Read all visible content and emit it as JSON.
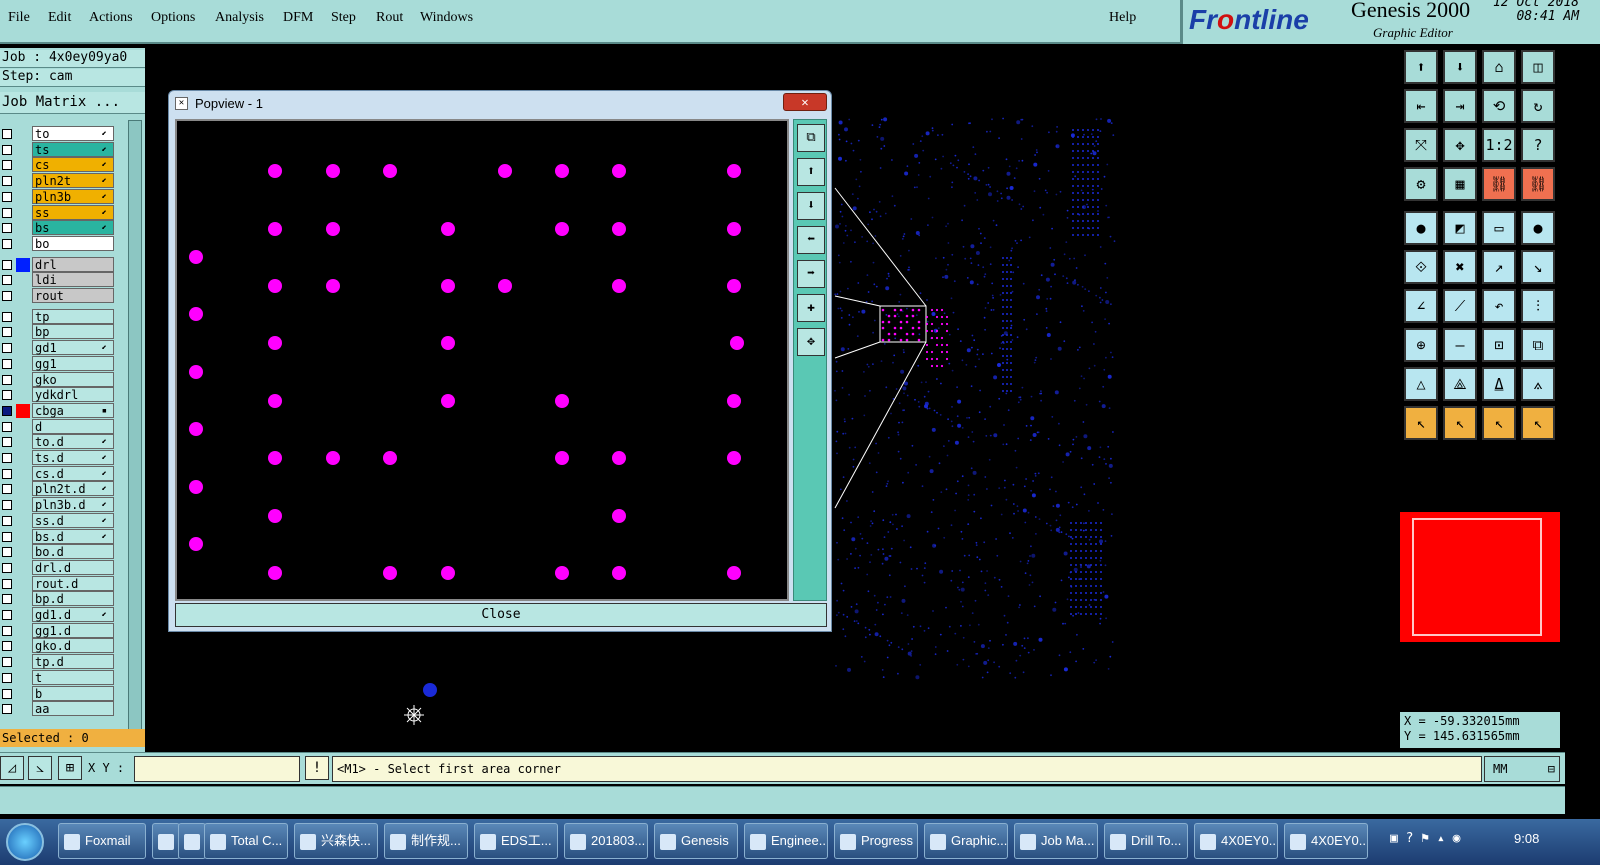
{
  "menu": [
    "File",
    "Edit",
    "Actions",
    "Options",
    "Analysis",
    "DFM",
    "Step",
    "Rout",
    "Windows"
  ],
  "help": "Help",
  "brand": {
    "logo_prefix": "Fr",
    "logo_o": "o",
    "logo_suffix": "ntline",
    "product": "Genesis 2000",
    "subtitle": "Graphic Editor",
    "date": "12 Oct 2018",
    "time": "08:41 AM"
  },
  "job": {
    "job_line": "Job : 4x0ey09ya0",
    "step_line": "Step: cam",
    "matrix_button": "Job Matrix ..."
  },
  "layers": [
    {
      "name": "to",
      "color": "#ffffff",
      "swatch": "",
      "arrow": "⬋"
    },
    {
      "name": "ts",
      "color": "#2ab4a0",
      "swatch": "",
      "arrow": "⬋"
    },
    {
      "name": "cs",
      "color": "#f0b000",
      "swatch": "",
      "arrow": "⬋"
    },
    {
      "name": "pln2t",
      "color": "#f0b000",
      "swatch": "",
      "arrow": "⬋"
    },
    {
      "name": "pln3b",
      "color": "#f0b000",
      "swatch": "",
      "arrow": "⬋"
    },
    {
      "name": "ss",
      "color": "#f0b000",
      "swatch": "",
      "arrow": "⬋"
    },
    {
      "name": "bs",
      "color": "#2ab4a0",
      "swatch": "",
      "arrow": "⬋"
    },
    {
      "name": "bo",
      "color": "#ffffff",
      "swatch": "",
      "arrow": ""
    },
    {
      "name": "drl",
      "color": "#c8c8c8",
      "swatch": "#0020ff",
      "arrow": ""
    },
    {
      "name": "ldi",
      "color": "#c8c8c8",
      "swatch": "",
      "arrow": ""
    },
    {
      "name": "rout",
      "color": "#c8c8c8",
      "swatch": "",
      "arrow": ""
    },
    {
      "name": "tp",
      "color": "#b8e6e2",
      "swatch": "",
      "arrow": ""
    },
    {
      "name": "bp",
      "color": "#b8e6e2",
      "swatch": "",
      "arrow": ""
    },
    {
      "name": "gd1",
      "color": "#b8e6e2",
      "swatch": "",
      "arrow": "⬋"
    },
    {
      "name": "gg1",
      "color": "#b8e6e2",
      "swatch": "",
      "arrow": ""
    },
    {
      "name": "gko",
      "color": "#b8e6e2",
      "swatch": "",
      "arrow": ""
    },
    {
      "name": "ydkdrl",
      "color": "#b8e6e2",
      "swatch": "",
      "arrow": ""
    },
    {
      "name": "cbga",
      "color": "#b8e6e2",
      "swatch": "#ff0000",
      "arrow": "▪"
    },
    {
      "name": "d",
      "color": "#b8e6e2",
      "swatch": "",
      "arrow": ""
    },
    {
      "name": "to.d",
      "color": "#b8e6e2",
      "swatch": "",
      "arrow": "⬋"
    },
    {
      "name": "ts.d",
      "color": "#b8e6e2",
      "swatch": "",
      "arrow": "⬋"
    },
    {
      "name": "cs.d",
      "color": "#b8e6e2",
      "swatch": "",
      "arrow": "⬋"
    },
    {
      "name": "pln2t.d",
      "color": "#b8e6e2",
      "swatch": "",
      "arrow": "⬋"
    },
    {
      "name": "pln3b.d",
      "color": "#b8e6e2",
      "swatch": "",
      "arrow": "⬋"
    },
    {
      "name": "ss.d",
      "color": "#b8e6e2",
      "swatch": "",
      "arrow": "⬋"
    },
    {
      "name": "bs.d",
      "color": "#b8e6e2",
      "swatch": "",
      "arrow": "⬋"
    },
    {
      "name": "bo.d",
      "color": "#b8e6e2",
      "swatch": "",
      "arrow": ""
    },
    {
      "name": "drl.d",
      "color": "#b8e6e2",
      "swatch": "",
      "arrow": ""
    },
    {
      "name": "rout.d",
      "color": "#b8e6e2",
      "swatch": "",
      "arrow": ""
    },
    {
      "name": "bp.d",
      "color": "#b8e6e2",
      "swatch": "",
      "arrow": ""
    },
    {
      "name": "gd1.d",
      "color": "#b8e6e2",
      "swatch": "",
      "arrow": "⬋"
    },
    {
      "name": "gg1.d",
      "color": "#b8e6e2",
      "swatch": "",
      "arrow": ""
    },
    {
      "name": "gko.d",
      "color": "#b8e6e2",
      "swatch": "",
      "arrow": ""
    },
    {
      "name": "tp.d",
      "color": "#b8e6e2",
      "swatch": "",
      "arrow": ""
    },
    {
      "name": "t",
      "color": "#b8e6e2",
      "swatch": "",
      "arrow": ""
    },
    {
      "name": "b",
      "color": "#b8e6e2",
      "swatch": "",
      "arrow": ""
    },
    {
      "name": "aa",
      "color": "#b8e6e2",
      "swatch": "",
      "arrow": ""
    }
  ],
  "selected": "Selected : 0",
  "command": {
    "xy_label": "X Y :",
    "xy_value": "",
    "bang": "!",
    "prompt": "<M1> - Select first area corner",
    "units": "MM"
  },
  "coords": {
    "x": "X = -59.332015mm",
    "y": "Y = 145.631565mm"
  },
  "popview": {
    "title": "Popview - 1",
    "close_label": "Close",
    "close_x": "✕"
  },
  "taskbar": {
    "items": [
      "Foxmail",
      "",
      "",
      "Total C...",
      "兴森快...",
      "制作规...",
      "EDS工...",
      "201803...",
      "Genesis",
      "Enginee...",
      "Progress",
      "Graphic...",
      "Job Ma...",
      "Drill To...",
      "4X0EY0...",
      "4X0EY0..."
    ],
    "clock": "9:08"
  },
  "colors": {
    "panel": "#a8dcd8",
    "pad": "#ff00ff",
    "board_feature": "#1a2ad8",
    "highlight": "#ff0000"
  }
}
